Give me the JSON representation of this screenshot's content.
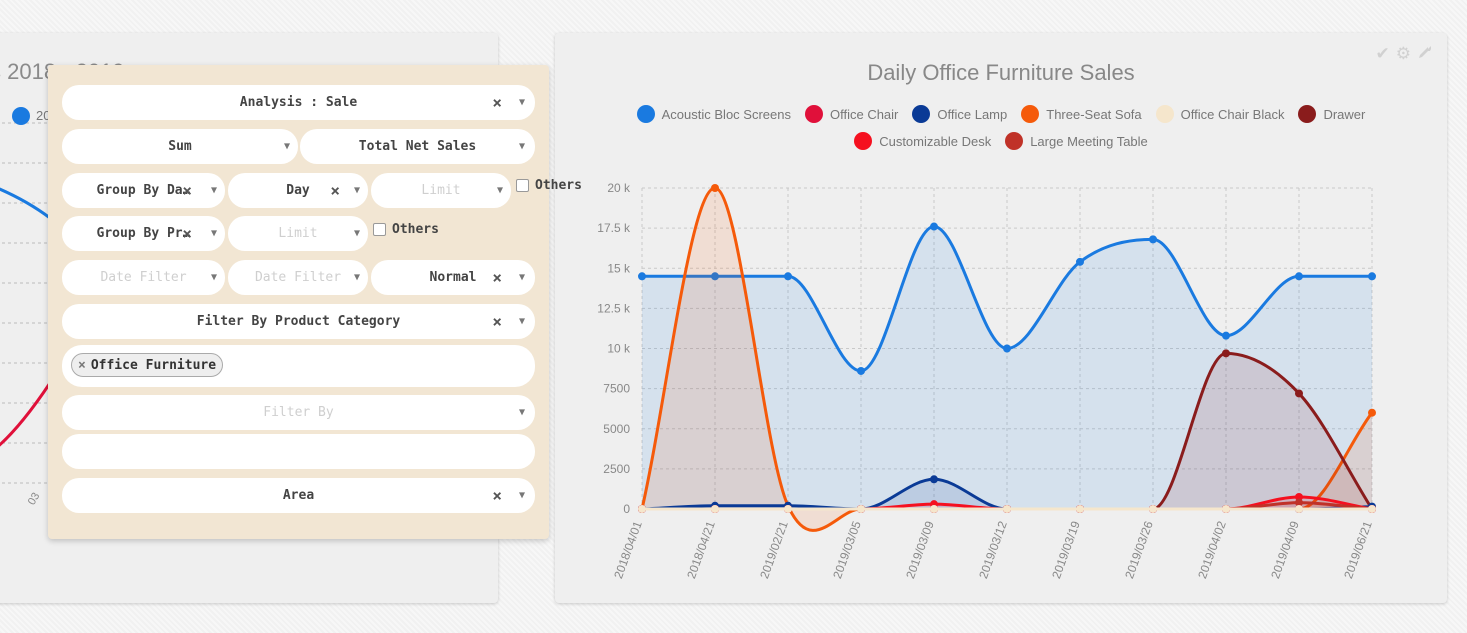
{
  "left_panel": {
    "title_fragment": "s 2018 - 2019",
    "legend_label": "20",
    "tick_label": "03",
    "colors": {
      "blue": "#1a7ae0",
      "red": "#e0103a"
    }
  },
  "chart_panel": {
    "tools": {
      "check_icon": "✔",
      "gear_icon": "⚙",
      "wrench_icon": "🔧"
    }
  },
  "settings": {
    "analysis": "Analysis : Sale",
    "aggregate": "Sum",
    "measure": "Total Net Sales",
    "group_by_date": "Group By Da…",
    "date_granularity": "Day",
    "limit_placeholder": "Limit",
    "others_label": "Others",
    "group_by_product": "Group By Pr…",
    "limit_placeholder_2": "Limit",
    "others_label_2": "Others",
    "date_filter_1": "Date Filter",
    "date_filter_2": "Date Filter",
    "mode": "Normal",
    "filter_by_category": "Filter By Product Category",
    "category_tag": "Office Furniture",
    "filter_by_placeholder": "Filter By",
    "chart_type": "Area",
    "clear_icon": "×",
    "caret_icon": "▼"
  },
  "chart_data": {
    "type": "area",
    "title": "Daily Office Furniture Sales",
    "x": [
      "2018/04/01",
      "2018/04/21",
      "2019/02/21",
      "2019/03/05",
      "2019/03/09",
      "2019/03/12",
      "2019/03/19",
      "2019/03/26",
      "2019/04/02",
      "2019/04/09",
      "2019/06/21"
    ],
    "ylim": [
      0,
      20000
    ],
    "yticks": [
      0,
      2500,
      5000,
      7500,
      10000,
      12500,
      15000,
      17500,
      20000
    ],
    "ytick_labels": [
      "0",
      "2500",
      "5000",
      "7500",
      "10 k",
      "12.5 k",
      "15 k",
      "17.5 k",
      "20 k"
    ],
    "grid": true,
    "legend_position": "top",
    "series": [
      {
        "name": "Acoustic Bloc Screens",
        "color": "#1a7ae0",
        "values": [
          14500,
          14500,
          14500,
          8600,
          17600,
          10000,
          15400,
          16800,
          10800,
          14500,
          14500
        ]
      },
      {
        "name": "Office Chair",
        "color": "#e0103a",
        "values": [
          0,
          0,
          0,
          0,
          0,
          0,
          0,
          0,
          0,
          0,
          0
        ]
      },
      {
        "name": "Office Lamp",
        "color": "#0a3a96",
        "values": [
          0,
          200,
          200,
          0,
          1850,
          0,
          0,
          0,
          0,
          0,
          150
        ]
      },
      {
        "name": "Three-Seat Sofa",
        "color": "#f55a0a",
        "values": [
          0,
          20000,
          200,
          0,
          0,
          0,
          0,
          0,
          0,
          0,
          6000
        ]
      },
      {
        "name": "Office Chair Black",
        "color": "#f5e6cc",
        "values": [
          0,
          0,
          0,
          0,
          0,
          0,
          0,
          0,
          0,
          0,
          0
        ]
      },
      {
        "name": "Drawer",
        "color": "#8a1c1c",
        "values": [
          0,
          0,
          0,
          0,
          0,
          0,
          0,
          0,
          9700,
          7200,
          0
        ]
      },
      {
        "name": "Customizable Desk",
        "color": "#f5101f",
        "values": [
          0,
          0,
          0,
          0,
          300,
          0,
          0,
          0,
          0,
          750,
          0
        ]
      },
      {
        "name": "Large Meeting Table",
        "color": "#c03228",
        "values": [
          0,
          0,
          0,
          0,
          0,
          0,
          0,
          0,
          0,
          400,
          0
        ]
      }
    ]
  }
}
